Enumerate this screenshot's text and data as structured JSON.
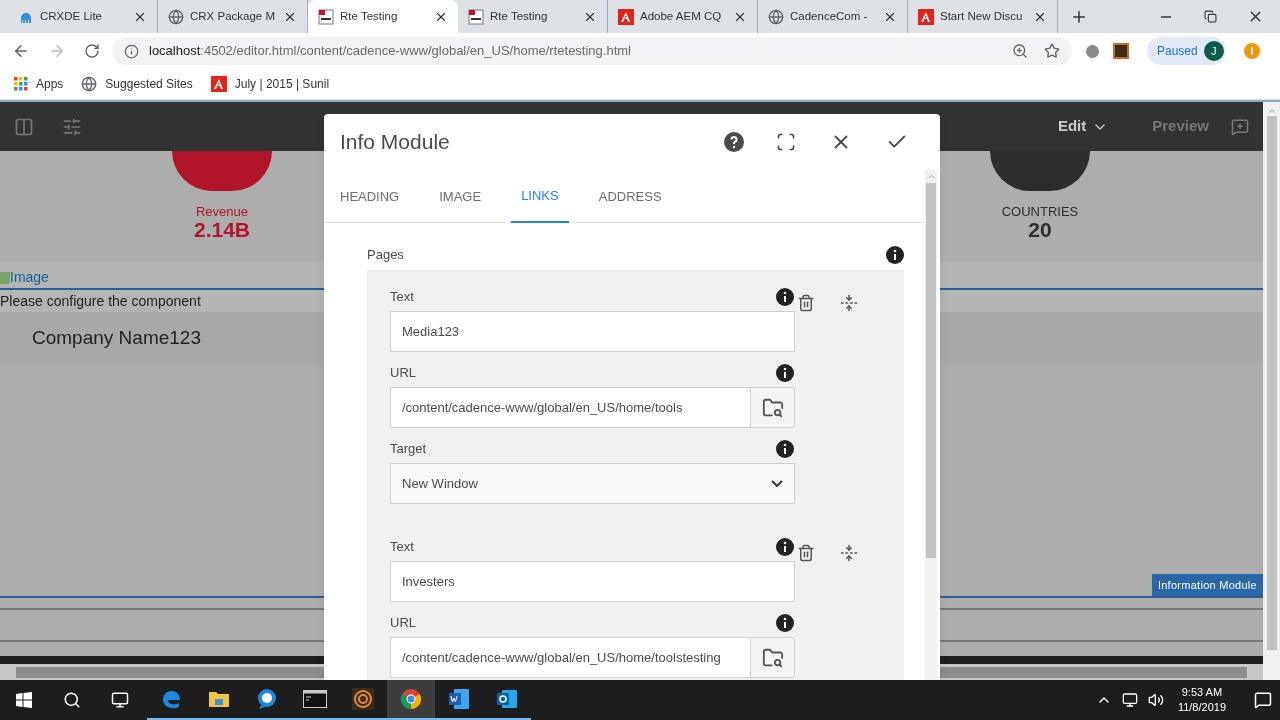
{
  "browser": {
    "tabs": [
      {
        "title": "CRXDE Lite",
        "kind": "crx",
        "selected": false
      },
      {
        "title": "CRX Package M",
        "kind": "globe",
        "selected": false
      },
      {
        "title": "Rte Testing",
        "kind": "cons",
        "selected": true
      },
      {
        "title": "Rte Testing",
        "kind": "cons",
        "selected": false
      },
      {
        "title": "Adobe AEM CQ",
        "kind": "adobe",
        "selected": false
      },
      {
        "title": "CadenceCom -",
        "kind": "globe",
        "selected": false
      },
      {
        "title": "Start New Discu",
        "kind": "adobe",
        "selected": false
      }
    ],
    "url_host": "localhost",
    "url_path": ":4502/editor.html/content/cadence-www/global/en_US/home/rtetesting.html",
    "profile": {
      "status": "Paused",
      "initial": "J"
    },
    "bookmarks": [
      {
        "label": "Apps",
        "kind": "apps"
      },
      {
        "label": "Suggested Sites",
        "kind": "globe"
      },
      {
        "label": "July | 2015 | Sunil",
        "kind": "adobe"
      }
    ]
  },
  "editor": {
    "mode": "Edit",
    "preview": "Preview"
  },
  "page": {
    "stats": [
      {
        "label": "Revenue",
        "value": "2.14B",
        "color": "#b0152a"
      },
      {
        "label": "COUNTRIES",
        "value": "20",
        "color": "#2e2c2c"
      }
    ],
    "image_link": "Image",
    "placeholder_text": "Please configure the component",
    "company": "Company Name123",
    "component_label": "Information Module"
  },
  "dialog": {
    "title": "Info Module",
    "tabs": [
      {
        "label": "HEADING",
        "selected": false
      },
      {
        "label": "IMAGE",
        "selected": false
      },
      {
        "label": "LINKS",
        "selected": true
      },
      {
        "label": "ADDRESS",
        "selected": false
      }
    ],
    "section_label": "Pages",
    "items": [
      {
        "fields": [
          {
            "kind": "text",
            "label": "Text",
            "value": "Media123"
          },
          {
            "kind": "path",
            "label": "URL",
            "value": "/content/cadence-www/global/en_US/home/tools"
          },
          {
            "kind": "select",
            "label": "Target",
            "value": "New Window"
          }
        ]
      },
      {
        "fields": [
          {
            "kind": "text",
            "label": "Text",
            "value": "Investers"
          },
          {
            "kind": "path",
            "label": "URL",
            "value": "/content/cadence-www/global/en_US/home/toolstesting"
          }
        ]
      }
    ]
  },
  "taskbar": {
    "apps": [
      {
        "kind": "edge",
        "selected": false
      },
      {
        "kind": "folder",
        "selected": false
      },
      {
        "kind": "chat",
        "selected": false
      },
      {
        "kind": "terminal",
        "selected": false
      },
      {
        "kind": "ring",
        "selected": false
      },
      {
        "kind": "chrome",
        "selected": true
      },
      {
        "kind": "word",
        "selected": false
      },
      {
        "kind": "outlook",
        "selected": false
      }
    ],
    "time": "9:53 AM",
    "date": "11/8/2019"
  }
}
